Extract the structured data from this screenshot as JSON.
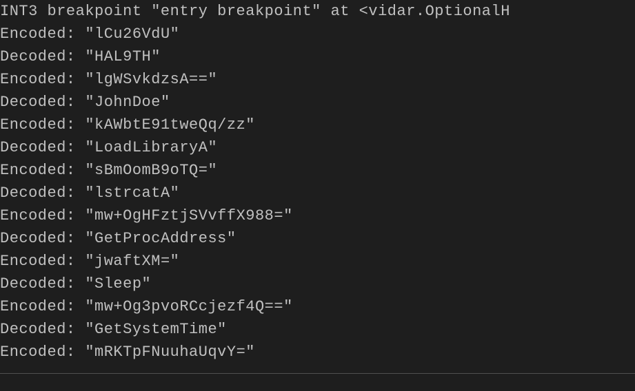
{
  "breakpoint_line": "INT3 breakpoint \"entry breakpoint\" at <vidar.OptionalH",
  "lines": [
    {
      "label": "Encoded:",
      "value": "\"lCu26VdU\""
    },
    {
      "label": "Decoded:",
      "value": "\"HAL9TH\""
    },
    {
      "label": "Encoded:",
      "value": "\"lgWSvkdzsA==\""
    },
    {
      "label": "Decoded:",
      "value": "\"JohnDoe\""
    },
    {
      "label": "Encoded:",
      "value": "\"kAWbtE91tweQq/zz\""
    },
    {
      "label": "Decoded:",
      "value": "\"LoadLibraryA\""
    },
    {
      "label": "Encoded:",
      "value": "\"sBmOomB9oTQ=\""
    },
    {
      "label": "Decoded:",
      "value": "\"lstrcatA\""
    },
    {
      "label": "Encoded:",
      "value": "\"mw+OgHFztjSVvffX988=\""
    },
    {
      "label": "Decoded:",
      "value": "\"GetProcAddress\""
    },
    {
      "label": "Encoded:",
      "value": "\"jwaftXM=\""
    },
    {
      "label": "Decoded:",
      "value": "\"Sleep\""
    },
    {
      "label": "Encoded:",
      "value": "\"mw+Og3pvoRCcjezf4Q==\""
    },
    {
      "label": "Decoded:",
      "value": "\"GetSystemTime\""
    },
    {
      "label": "Encoded:",
      "value": "\"mRKTpFNuuhaUqvY=\""
    }
  ]
}
